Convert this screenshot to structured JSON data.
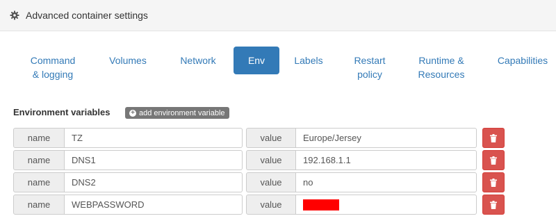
{
  "header": {
    "title": "Advanced container settings",
    "icon": "gear-icon"
  },
  "tabs": [
    {
      "label": "Command & logging",
      "line1": "Command",
      "line2": "& logging"
    },
    {
      "label": "Volumes"
    },
    {
      "label": "Network"
    },
    {
      "label": "Env",
      "active": true
    },
    {
      "label": "Labels"
    },
    {
      "label": "Restart policy",
      "line1": "Restart",
      "line2": "policy"
    },
    {
      "label": "Runtime & Resources",
      "line1": "Runtime &",
      "line2": "Resources"
    },
    {
      "label": "Capabilities"
    }
  ],
  "env": {
    "section_label": "Environment variables",
    "add_button_label": "add environment variable",
    "name_addon": "name",
    "value_addon": "value",
    "rows": [
      {
        "name": "TZ",
        "value": "Europe/Jersey"
      },
      {
        "name": "DNS1",
        "value": "192.168.1.1"
      },
      {
        "name": "DNS2",
        "value": "no"
      },
      {
        "name": "WEBPASSWORD",
        "value": "",
        "redacted": true
      }
    ]
  },
  "colors": {
    "accent": "#337ab7",
    "danger": "#d9534f",
    "redaction": "#ff0000"
  }
}
